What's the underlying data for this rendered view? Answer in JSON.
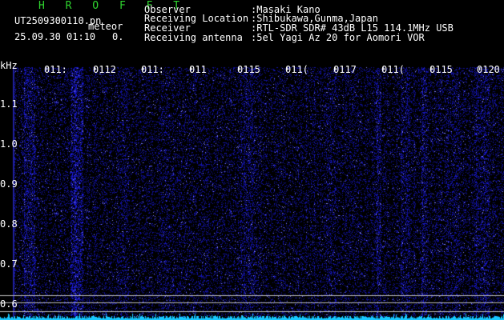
{
  "header": {
    "app_name": "H R O F F T",
    "filename": "UT2509300110.pn",
    "mode_label": "meteor",
    "datetime": "25.09.30 01:10",
    "count": "0.",
    "info": [
      {
        "label": "Observer",
        "value": ":Masaki Kano"
      },
      {
        "label": "Receiving Location",
        "value": ":Shibukawa,Gunma,Japan"
      },
      {
        "label": "Receiver",
        "value": ":RTL-SDR SDR# 43dB L15 114.1MHz USB"
      },
      {
        "label": "Receiving antenna",
        "value": ":5el Yagi Az 20 for Aomori VOR"
      }
    ]
  },
  "axis": {
    "unit": "kHz",
    "freq_ticks": [
      "1.1",
      "1.0",
      "0.9",
      "0.8",
      "0.7",
      "0.6"
    ],
    "time_ticks": [
      "011:",
      "0112",
      "011:",
      "011",
      "0115",
      "011(",
      "0117",
      "011(",
      "0115",
      "0120"
    ]
  },
  "colors": {
    "background": "#000000",
    "signal": "#1a1aff",
    "bright": "#6a6aff",
    "trace": "#18c8ff",
    "header_title": "#2fd52f"
  }
}
